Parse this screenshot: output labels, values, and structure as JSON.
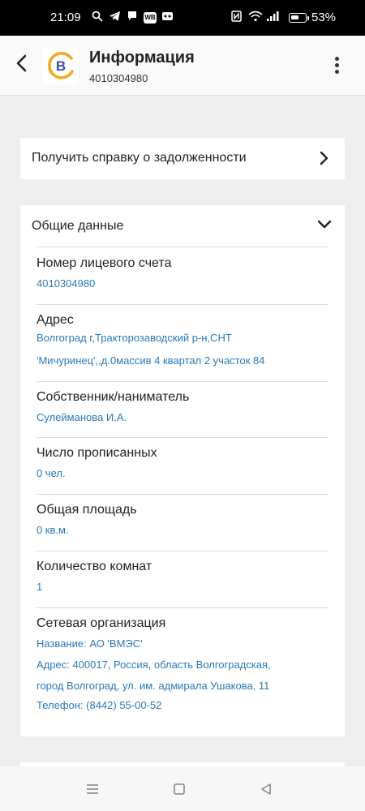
{
  "status_bar": {
    "time": "21:09",
    "battery_pct": "53%",
    "wb_badge": "WB"
  },
  "app_bar": {
    "title": "Информация",
    "subtitle": "4010304980",
    "logo_letter": "B"
  },
  "debt_card": {
    "label": "Получить справку о задолженности"
  },
  "general": {
    "title": "Общие данные",
    "fields": [
      {
        "label": "Номер лицевого счета",
        "lines": [
          "4010304980"
        ]
      },
      {
        "label": "Адрес",
        "lines": [
          "Волгоград г,Тракторозаводский р-н,СНТ",
          "'Мичуринец',,д.0массив 4 квартал 2 участок 84"
        ]
      },
      {
        "label": "Собственник/наниматель",
        "lines": [
          "Сулейманова И.А."
        ]
      },
      {
        "label": "Число прописанных",
        "lines": [
          "0 чел."
        ]
      },
      {
        "label": "Общая площадь",
        "lines": [
          "0 кв.м."
        ]
      },
      {
        "label": "Количество комнат",
        "lines": [
          "1"
        ]
      },
      {
        "label": "Сетевая организация",
        "lines": [
          "Название: АО 'ВМЭС'",
          "Адрес: 400017, Россия, область Волгоградская,",
          "город Волгоград, ул. им. адмирала Ушакова, 11",
          "Телефон: (8442) 55-00-52"
        ]
      }
    ]
  },
  "colors": {
    "accent_link": "#2a7ab8",
    "logo_ring": "#f0a91c",
    "logo_letter": "#3b4ea6"
  }
}
